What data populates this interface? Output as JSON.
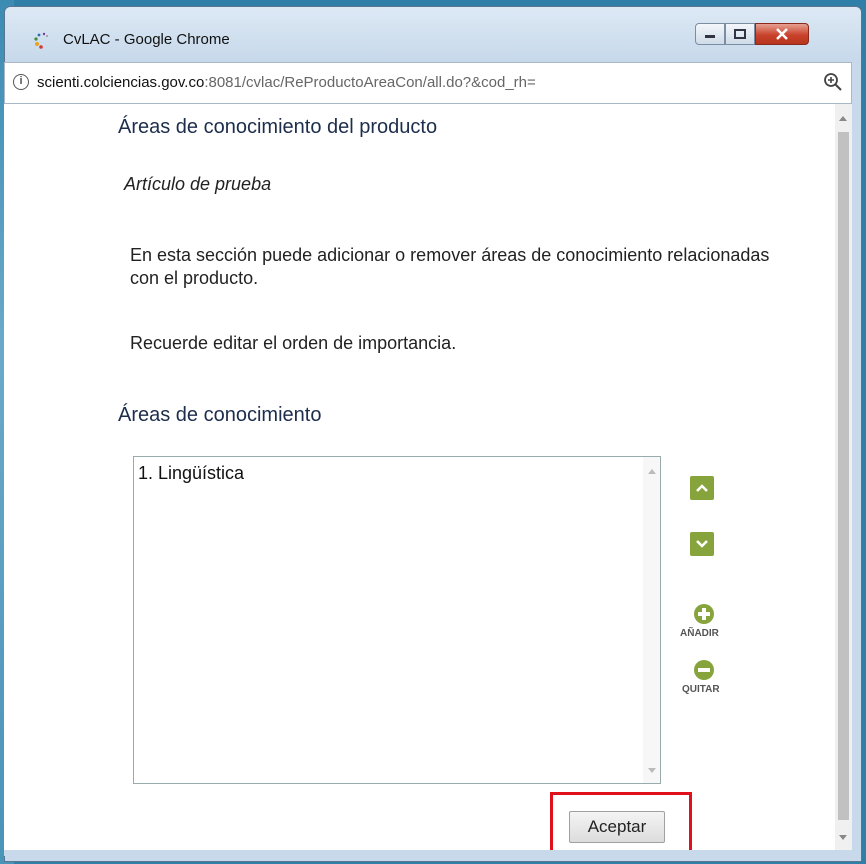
{
  "window": {
    "title": "CvLAC - Google Chrome"
  },
  "address_bar": {
    "domain": "scienti.colciencias.gov.co",
    "path": ":8081/cvlac/ReProductoAreaCon/all.do?&cod_rh="
  },
  "page": {
    "heading": "Áreas de conocimiento del producto",
    "product_name": "Artículo de prueba",
    "instructions": "En esta sección puede adicionar o remover áreas de conocimiento relacionadas con el producto.",
    "reminder": "Recuerde editar el orden de importancia.",
    "section_heading": "Áreas de conocimiento",
    "areas": [
      "1. Lingüística"
    ],
    "add_label": "AÑADIR",
    "remove_label": "QUITAR",
    "accept_label": "Aceptar"
  },
  "colors": {
    "accent_green": "#87a33c",
    "highlight_red": "#e0111b",
    "heading_navy": "#1d2d4c"
  }
}
